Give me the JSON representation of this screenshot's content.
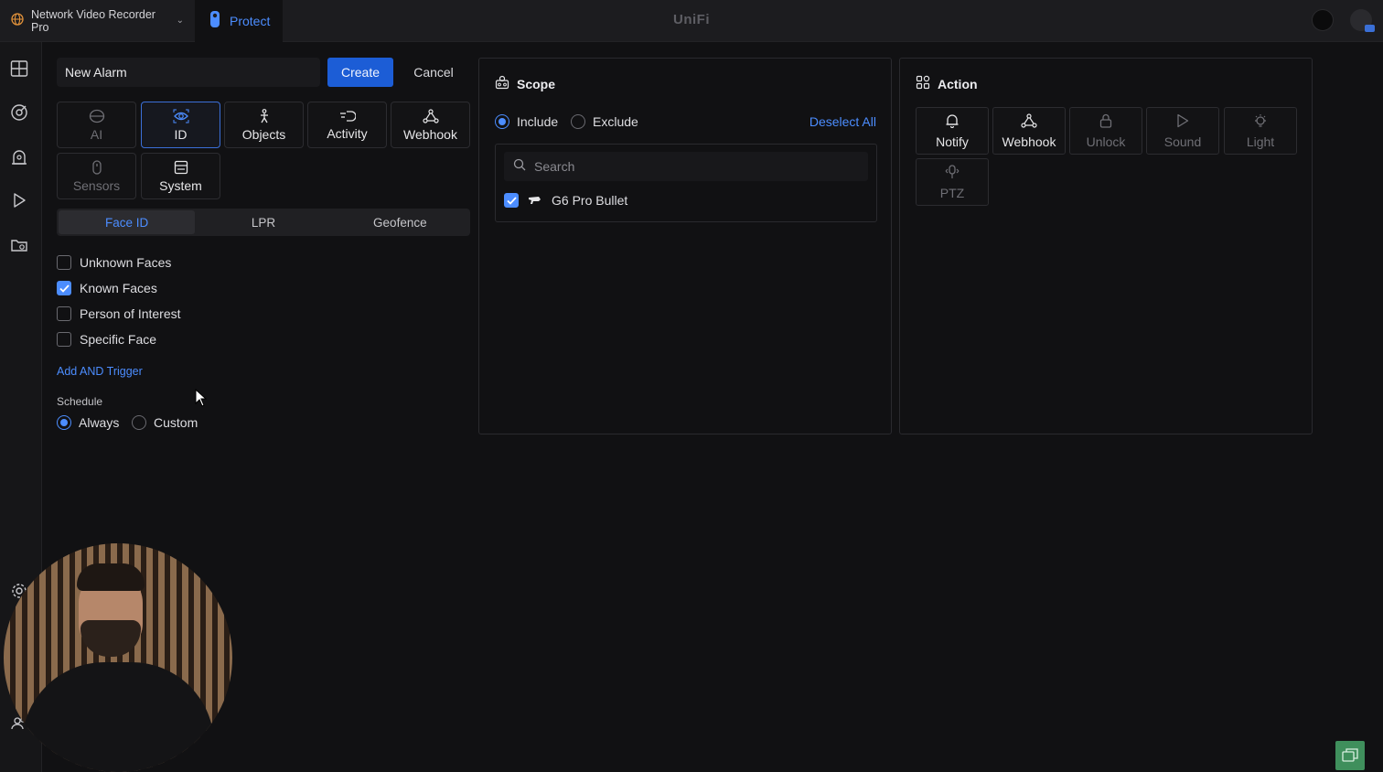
{
  "topbar": {
    "console_name": "Network Video Recorder Pro",
    "app_name": "Protect",
    "brand": "UniFi"
  },
  "form": {
    "alarm_name": "New Alarm",
    "create_label": "Create",
    "cancel_label": "Cancel"
  },
  "triggers": [
    {
      "label": "AI",
      "icon": "ai-icon",
      "state": "disabled"
    },
    {
      "label": "ID",
      "icon": "id-icon",
      "state": "selected"
    },
    {
      "label": "Objects",
      "icon": "objects-icon",
      "state": "normal"
    },
    {
      "label": "Activity",
      "icon": "activity-icon",
      "state": "normal"
    },
    {
      "label": "Webhook",
      "icon": "webhook-icon",
      "state": "normal"
    },
    {
      "label": "Sensors",
      "icon": "sensors-icon",
      "state": "disabled"
    },
    {
      "label": "System",
      "icon": "system-icon",
      "state": "normal"
    }
  ],
  "id_tabs": [
    {
      "label": "Face ID",
      "active": true
    },
    {
      "label": "LPR",
      "active": false
    },
    {
      "label": "Geofence",
      "active": false
    }
  ],
  "face_options": [
    {
      "label": "Unknown Faces",
      "checked": false
    },
    {
      "label": "Known Faces",
      "checked": true
    },
    {
      "label": "Person of Interest",
      "checked": false
    },
    {
      "label": "Specific Face",
      "checked": false
    }
  ],
  "add_trigger_label": "Add AND Trigger",
  "schedule": {
    "label": "Schedule",
    "always_label": "Always",
    "custom_label": "Custom",
    "selected": "Always"
  },
  "scope": {
    "title": "Scope",
    "include_label": "Include",
    "exclude_label": "Exclude",
    "selected": "Include",
    "deselect_label": "Deselect All",
    "search_placeholder": "Search",
    "cameras": [
      {
        "name": "G6 Pro Bullet",
        "checked": true
      }
    ]
  },
  "action": {
    "title": "Action",
    "items": [
      {
        "label": "Notify",
        "icon": "bell-icon",
        "state": "normal"
      },
      {
        "label": "Webhook",
        "icon": "webhook-icon",
        "state": "normal"
      },
      {
        "label": "Unlock",
        "icon": "lock-icon",
        "state": "disabled"
      },
      {
        "label": "Sound",
        "icon": "play-icon",
        "state": "disabled"
      },
      {
        "label": "Light",
        "icon": "light-icon",
        "state": "disabled"
      },
      {
        "label": "PTZ",
        "icon": "ptz-icon",
        "state": "disabled"
      }
    ]
  },
  "colors": {
    "accent": "#4c8dff",
    "primary_button": "#1c5dd6",
    "background": "#111113"
  }
}
